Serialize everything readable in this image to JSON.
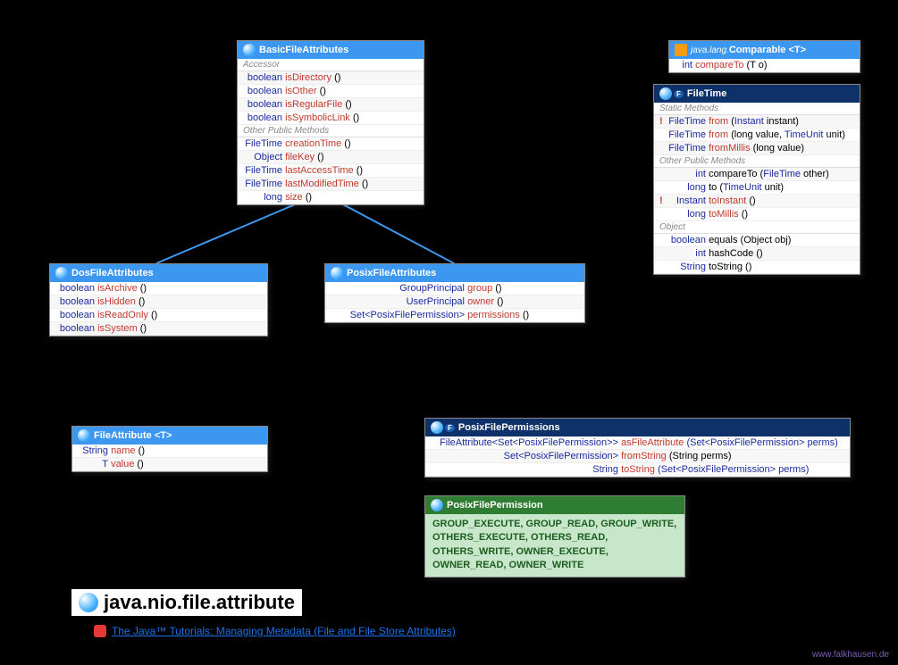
{
  "package": "java.nio.file.attribute",
  "tutorial": "The Java™ Tutorials: Managing Metadata (File and File Store Attributes)",
  "watermark": "www.falkhausen.de",
  "classes": {
    "basic": {
      "title": "BasicFileAttributes",
      "sections": {
        "accessor": "Accessor",
        "other": "Other Public Methods"
      },
      "rows": [
        {
          "ret": "boolean",
          "name": "isDirectory",
          "args": "()"
        },
        {
          "ret": "boolean",
          "name": "isOther",
          "args": "()"
        },
        {
          "ret": "boolean",
          "name": "isRegularFile",
          "args": "()"
        },
        {
          "ret": "boolean",
          "name": "isSymbolicLink",
          "args": "()"
        },
        {
          "ret": "FileTime",
          "name": "creationTime",
          "args": "()"
        },
        {
          "ret": "Object",
          "name": "fileKey",
          "args": "()"
        },
        {
          "ret": "FileTime",
          "name": "lastAccessTime",
          "args": "()"
        },
        {
          "ret": "FileTime",
          "name": "lastModifiedTime",
          "args": "()"
        },
        {
          "ret": "long",
          "name": "size",
          "args": "()"
        }
      ]
    },
    "dos": {
      "title": "DosFileAttributes",
      "rows": [
        {
          "ret": "boolean",
          "name": "isArchive",
          "args": "()"
        },
        {
          "ret": "boolean",
          "name": "isHidden",
          "args": "()"
        },
        {
          "ret": "boolean",
          "name": "isReadOnly",
          "args": "()"
        },
        {
          "ret": "boolean",
          "name": "isSystem",
          "args": "()"
        }
      ]
    },
    "posix": {
      "title": "PosixFileAttributes",
      "rows": [
        {
          "ret": "GroupPrincipal",
          "name": "group",
          "args": "()"
        },
        {
          "ret": "UserPrincipal",
          "name": "owner",
          "args": "()"
        },
        {
          "ret": "Set<PosixFilePermission>",
          "name": "permissions",
          "args": "()"
        }
      ]
    },
    "fileattr": {
      "title": "FileAttribute",
      "generic": "<T>",
      "rows": [
        {
          "ret": "String",
          "name": "name",
          "args": "()"
        },
        {
          "ret": "T",
          "name": "value",
          "args": "()"
        }
      ]
    },
    "comparable": {
      "pkg": "java.lang.",
      "title": "Comparable",
      "generic": "<T>",
      "rows": [
        {
          "ret": "int",
          "name": "compareTo",
          "args": "(T o)"
        }
      ]
    },
    "filetime": {
      "title": "FileTime",
      "badge": "F",
      "sections": {
        "static": "Static Methods",
        "other": "Other Public Methods",
        "object": "Object"
      },
      "static_rows": [
        {
          "excl": "!",
          "ret": "FileTime",
          "name": "from",
          "args_pre": "(",
          "args_type": "Instant",
          "args_post": " instant)"
        },
        {
          "excl": "",
          "ret": "FileTime",
          "name": "from",
          "args_pre": "(long value, ",
          "args_type": "TimeUnit",
          "args_post": " unit)"
        },
        {
          "excl": "",
          "ret": "FileTime",
          "name": "fromMillis",
          "args_pre": "(long value)",
          "args_type": "",
          "args_post": ""
        }
      ],
      "other_rows": [
        {
          "excl": "",
          "ret": "int",
          "name": "compareTo",
          "args_pre": "(",
          "args_type": "FileTime",
          "args_post": " other)"
        },
        {
          "excl": "",
          "ret": "long",
          "name": "to",
          "args_pre": "(",
          "args_type": "TimeUnit",
          "args_post": " unit)"
        },
        {
          "excl": "!",
          "ret": "Instant",
          "name": "toInstant",
          "args_pre": "()",
          "args_type": "",
          "args_post": ""
        },
        {
          "excl": "",
          "ret": "long",
          "name": "toMillis",
          "args_pre": "()",
          "args_type": "",
          "args_post": ""
        }
      ],
      "object_rows": [
        {
          "ret": "boolean",
          "name": "equals",
          "args": "(Object obj)"
        },
        {
          "ret": "int",
          "name": "hashCode",
          "args": "()"
        },
        {
          "ret": "String",
          "name": "toString",
          "args": "()"
        }
      ]
    },
    "permissions": {
      "title": "PosixFilePermissions",
      "badge": "F",
      "rows": [
        {
          "ret": "FileAttribute<Set<PosixFilePermission>>",
          "name": "asFileAttribute",
          "args": "(Set<PosixFilePermission> perms)"
        },
        {
          "ret": "Set<PosixFilePermission>",
          "name": "fromString",
          "args": "(String perms)"
        },
        {
          "ret": "String",
          "name": "toString",
          "args": "(Set<PosixFilePermission> perms)"
        }
      ]
    },
    "permission": {
      "title": "PosixFilePermission",
      "values": "GROUP_EXECUTE, GROUP_READ, GROUP_WRITE, OTHERS_EXECUTE, OTHERS_READ, OTHERS_WRITE, OWNER_EXECUTE, OWNER_READ, OWNER_WRITE"
    }
  }
}
